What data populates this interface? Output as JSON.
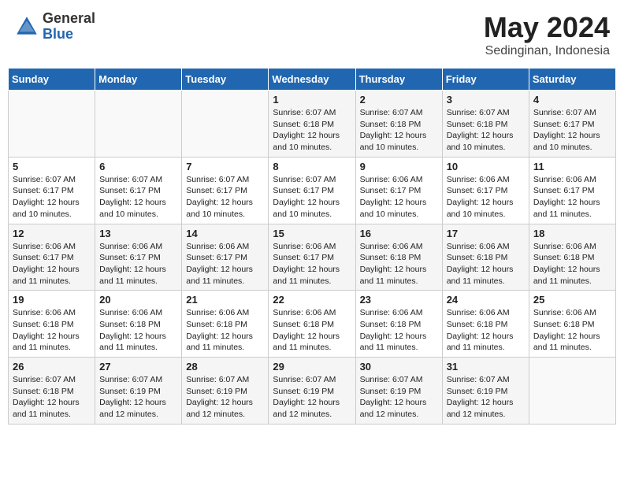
{
  "header": {
    "logo_general": "General",
    "logo_blue": "Blue",
    "title": "May 2024",
    "subtitle": "Sedinginan, Indonesia"
  },
  "weekdays": [
    "Sunday",
    "Monday",
    "Tuesday",
    "Wednesday",
    "Thursday",
    "Friday",
    "Saturday"
  ],
  "weeks": [
    [
      {
        "day": "",
        "info": ""
      },
      {
        "day": "",
        "info": ""
      },
      {
        "day": "",
        "info": ""
      },
      {
        "day": "1",
        "info": "Sunrise: 6:07 AM\nSunset: 6:18 PM\nDaylight: 12 hours\nand 10 minutes."
      },
      {
        "day": "2",
        "info": "Sunrise: 6:07 AM\nSunset: 6:18 PM\nDaylight: 12 hours\nand 10 minutes."
      },
      {
        "day": "3",
        "info": "Sunrise: 6:07 AM\nSunset: 6:18 PM\nDaylight: 12 hours\nand 10 minutes."
      },
      {
        "day": "4",
        "info": "Sunrise: 6:07 AM\nSunset: 6:17 PM\nDaylight: 12 hours\nand 10 minutes."
      }
    ],
    [
      {
        "day": "5",
        "info": "Sunrise: 6:07 AM\nSunset: 6:17 PM\nDaylight: 12 hours\nand 10 minutes."
      },
      {
        "day": "6",
        "info": "Sunrise: 6:07 AM\nSunset: 6:17 PM\nDaylight: 12 hours\nand 10 minutes."
      },
      {
        "day": "7",
        "info": "Sunrise: 6:07 AM\nSunset: 6:17 PM\nDaylight: 12 hours\nand 10 minutes."
      },
      {
        "day": "8",
        "info": "Sunrise: 6:07 AM\nSunset: 6:17 PM\nDaylight: 12 hours\nand 10 minutes."
      },
      {
        "day": "9",
        "info": "Sunrise: 6:06 AM\nSunset: 6:17 PM\nDaylight: 12 hours\nand 10 minutes."
      },
      {
        "day": "10",
        "info": "Sunrise: 6:06 AM\nSunset: 6:17 PM\nDaylight: 12 hours\nand 10 minutes."
      },
      {
        "day": "11",
        "info": "Sunrise: 6:06 AM\nSunset: 6:17 PM\nDaylight: 12 hours\nand 11 minutes."
      }
    ],
    [
      {
        "day": "12",
        "info": "Sunrise: 6:06 AM\nSunset: 6:17 PM\nDaylight: 12 hours\nand 11 minutes."
      },
      {
        "day": "13",
        "info": "Sunrise: 6:06 AM\nSunset: 6:17 PM\nDaylight: 12 hours\nand 11 minutes."
      },
      {
        "day": "14",
        "info": "Sunrise: 6:06 AM\nSunset: 6:17 PM\nDaylight: 12 hours\nand 11 minutes."
      },
      {
        "day": "15",
        "info": "Sunrise: 6:06 AM\nSunset: 6:17 PM\nDaylight: 12 hours\nand 11 minutes."
      },
      {
        "day": "16",
        "info": "Sunrise: 6:06 AM\nSunset: 6:18 PM\nDaylight: 12 hours\nand 11 minutes."
      },
      {
        "day": "17",
        "info": "Sunrise: 6:06 AM\nSunset: 6:18 PM\nDaylight: 12 hours\nand 11 minutes."
      },
      {
        "day": "18",
        "info": "Sunrise: 6:06 AM\nSunset: 6:18 PM\nDaylight: 12 hours\nand 11 minutes."
      }
    ],
    [
      {
        "day": "19",
        "info": "Sunrise: 6:06 AM\nSunset: 6:18 PM\nDaylight: 12 hours\nand 11 minutes."
      },
      {
        "day": "20",
        "info": "Sunrise: 6:06 AM\nSunset: 6:18 PM\nDaylight: 12 hours\nand 11 minutes."
      },
      {
        "day": "21",
        "info": "Sunrise: 6:06 AM\nSunset: 6:18 PM\nDaylight: 12 hours\nand 11 minutes."
      },
      {
        "day": "22",
        "info": "Sunrise: 6:06 AM\nSunset: 6:18 PM\nDaylight: 12 hours\nand 11 minutes."
      },
      {
        "day": "23",
        "info": "Sunrise: 6:06 AM\nSunset: 6:18 PM\nDaylight: 12 hours\nand 11 minutes."
      },
      {
        "day": "24",
        "info": "Sunrise: 6:06 AM\nSunset: 6:18 PM\nDaylight: 12 hours\nand 11 minutes."
      },
      {
        "day": "25",
        "info": "Sunrise: 6:06 AM\nSunset: 6:18 PM\nDaylight: 12 hours\nand 11 minutes."
      }
    ],
    [
      {
        "day": "26",
        "info": "Sunrise: 6:07 AM\nSunset: 6:18 PM\nDaylight: 12 hours\nand 11 minutes."
      },
      {
        "day": "27",
        "info": "Sunrise: 6:07 AM\nSunset: 6:19 PM\nDaylight: 12 hours\nand 12 minutes."
      },
      {
        "day": "28",
        "info": "Sunrise: 6:07 AM\nSunset: 6:19 PM\nDaylight: 12 hours\nand 12 minutes."
      },
      {
        "day": "29",
        "info": "Sunrise: 6:07 AM\nSunset: 6:19 PM\nDaylight: 12 hours\nand 12 minutes."
      },
      {
        "day": "30",
        "info": "Sunrise: 6:07 AM\nSunset: 6:19 PM\nDaylight: 12 hours\nand 12 minutes."
      },
      {
        "day": "31",
        "info": "Sunrise: 6:07 AM\nSunset: 6:19 PM\nDaylight: 12 hours\nand 12 minutes."
      },
      {
        "day": "",
        "info": ""
      }
    ]
  ]
}
